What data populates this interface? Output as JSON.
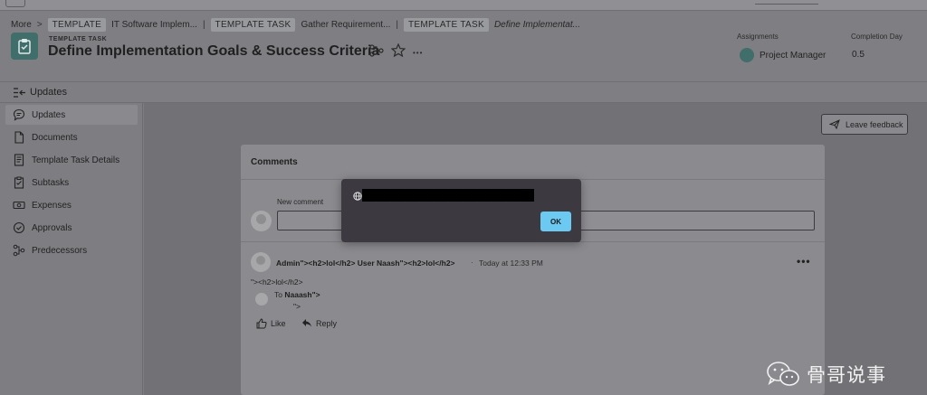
{
  "breadcrumb": {
    "more": "More",
    "chevron": ">",
    "chip1": "TEMPLATE",
    "crumb1": "IT Software Implem...",
    "chip2": "TEMPLATE TASK",
    "crumb2": "Gather Requirement...",
    "chip3": "TEMPLATE TASK",
    "crumb3": "Define Implementat..."
  },
  "header": {
    "object_type": "TEMPLATE TASK",
    "title": "Define Implementation Goals & Success Criteria",
    "more_glyph": "•••",
    "assignments_label": "Assignments",
    "assignee": "Project Manager",
    "completion_label": "Completion Day",
    "completion_value": "0.5"
  },
  "section": {
    "label": "Updates"
  },
  "sidebar": {
    "items": [
      {
        "label": "Updates",
        "icon": "speech-bubble-icon",
        "active": true
      },
      {
        "label": "Documents",
        "icon": "document-icon"
      },
      {
        "label": "Template Task Details",
        "icon": "details-icon"
      },
      {
        "label": "Subtasks",
        "icon": "subtasks-icon"
      },
      {
        "label": "Expenses",
        "icon": "expenses-icon"
      },
      {
        "label": "Approvals",
        "icon": "approvals-icon"
      },
      {
        "label": "Predecessors",
        "icon": "predecessors-icon"
      }
    ]
  },
  "feedback": {
    "label": "Leave feedback"
  },
  "comments": {
    "title": "Comments",
    "new_comment_label": "New comment",
    "item": {
      "author": "Admin\"><h2>lol</h2> User Naash\"><h2>lol</h2>",
      "separator": "·",
      "time": "Today at 12:33 PM",
      "more": "•••",
      "body": "\"><h2>lol</h2>",
      "to_prefix": "To",
      "to_name": "Naaash\">",
      "quote": "\">",
      "like": "Like",
      "reply": "Reply"
    }
  },
  "dialog": {
    "ok": "OK"
  },
  "watermark": {
    "text": "骨哥说事"
  },
  "colors": {
    "accent": "#3f6e6b",
    "ok_button": "#6cc9f2",
    "dialog_bg": "#3c3a40"
  }
}
